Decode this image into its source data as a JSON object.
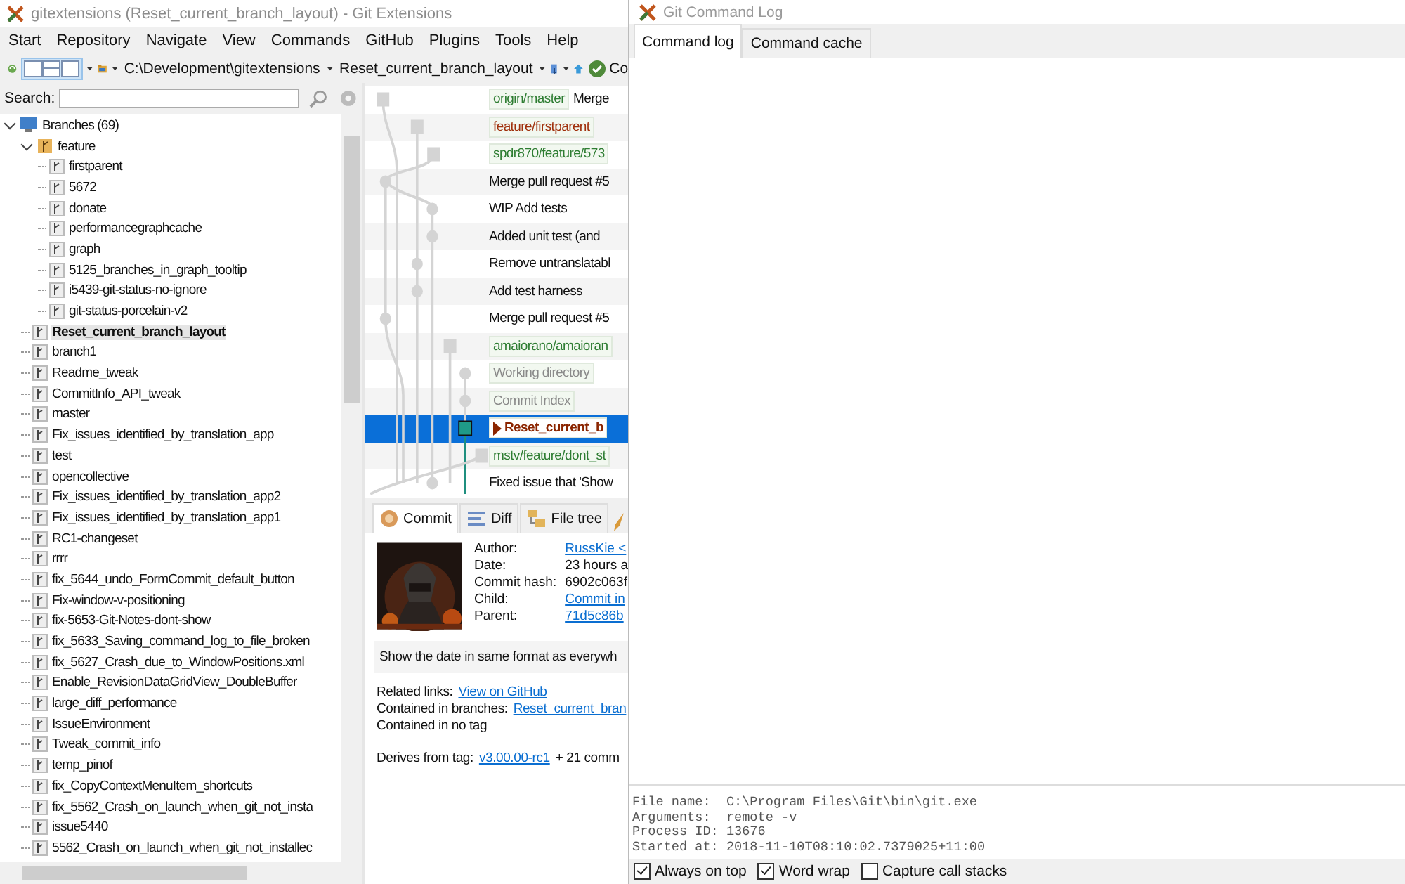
{
  "main_window": {
    "title": "gitextensions (Reset_current_branch_layout) - Git Extensions"
  },
  "menu": [
    "Start",
    "Repository",
    "Navigate",
    "View",
    "Commands",
    "GitHub",
    "Plugins",
    "Tools",
    "Help"
  ],
  "toolbar": {
    "repository": "C:\\Development\\gitextensions",
    "branch": "Reset_current_branch_layout",
    "button_text": "Co"
  },
  "sidebar": {
    "search_label": "Search:",
    "tree": [
      {
        "label": "Branches (69)",
        "kind": "root",
        "expanded": true,
        "selected": false,
        "children": [
          {
            "label": "feature",
            "kind": "folder",
            "expanded": true,
            "selected": false,
            "children": [
              {
                "label": "firstparent",
                "kind": "branch",
                "selected": false
              },
              {
                "label": "5672",
                "kind": "branch",
                "selected": false
              },
              {
                "label": "donate",
                "kind": "branch",
                "selected": false
              },
              {
                "label": "performancegraphcache",
                "kind": "branch",
                "selected": false
              },
              {
                "label": "graph",
                "kind": "branch",
                "selected": false
              },
              {
                "label": "5125_branches_in_graph_tooltip",
                "kind": "branch",
                "selected": false
              },
              {
                "label": "i5439-git-status-no-ignore",
                "kind": "branch",
                "selected": false
              },
              {
                "label": "git-status-porcelain-v2",
                "kind": "branch",
                "selected": false
              }
            ]
          },
          {
            "label": "Reset_current_branch_layout",
            "kind": "branch",
            "selected": true
          },
          {
            "label": "branch1",
            "kind": "branch",
            "selected": false
          },
          {
            "label": "Readme_tweak",
            "kind": "branch",
            "selected": false
          },
          {
            "label": "CommitInfo_API_tweak",
            "kind": "branch",
            "selected": false
          },
          {
            "label": "master",
            "kind": "branch",
            "selected": false
          },
          {
            "label": "Fix_issues_identified_by_translation_app",
            "kind": "branch",
            "selected": false
          },
          {
            "label": "test",
            "kind": "branch",
            "selected": false
          },
          {
            "label": "opencollective",
            "kind": "branch",
            "selected": false
          },
          {
            "label": "Fix_issues_identified_by_translation_app2",
            "kind": "branch",
            "selected": false
          },
          {
            "label": "Fix_issues_identified_by_translation_app1",
            "kind": "branch",
            "selected": false
          },
          {
            "label": "RC1-changeset",
            "kind": "branch",
            "selected": false
          },
          {
            "label": "rrrr",
            "kind": "branch",
            "selected": false
          },
          {
            "label": "fix_5644_undo_FormCommit_default_button",
            "kind": "branch",
            "selected": false
          },
          {
            "label": "Fix-window-v-positioning",
            "kind": "branch",
            "selected": false
          },
          {
            "label": "fix-5653-Git-Notes-dont-show",
            "kind": "branch",
            "selected": false
          },
          {
            "label": "fix_5633_Saving_command_log_to_file_broken",
            "kind": "branch",
            "selected": false
          },
          {
            "label": "fix_5627_Crash_due_to_WindowPositions.xml",
            "kind": "branch",
            "selected": false
          },
          {
            "label": "Enable_RevisionDataGridView_DoubleBuffer",
            "kind": "branch",
            "selected": false
          },
          {
            "label": "large_diff_performance",
            "kind": "branch",
            "selected": false
          },
          {
            "label": "IssueEnvironment",
            "kind": "branch",
            "selected": false
          },
          {
            "label": "Tweak_commit_info",
            "kind": "branch",
            "selected": false
          },
          {
            "label": "temp_pinof",
            "kind": "branch",
            "selected": false
          },
          {
            "label": "fix_CopyContextMenuItem_shortcuts",
            "kind": "branch",
            "selected": false
          },
          {
            "label": "fix_5562_Crash_on_launch_when_git_not_insta",
            "kind": "branch",
            "selected": false
          },
          {
            "label": "issue5440",
            "kind": "branch",
            "selected": false
          },
          {
            "label": "5562_Crash_on_launch_when_git_not_installec",
            "kind": "branch",
            "selected": false
          }
        ]
      }
    ]
  },
  "revisions": [
    {
      "ref": {
        "text": "origin/master",
        "color": "#2e7d32",
        "head": false
      },
      "message": "Merge",
      "selected": false
    },
    {
      "ref": {
        "text": "feature/firstparent",
        "color": "#a0300c",
        "head": false
      },
      "selected": false
    },
    {
      "ref": {
        "text": "spdr870/feature/573",
        "color": "#2e7d32",
        "head": false
      },
      "selected": false
    },
    {
      "message": "Merge pull request #5",
      "selected": false
    },
    {
      "message": "WIP Add tests",
      "selected": false
    },
    {
      "message": "Added unit test (and",
      "selected": false
    },
    {
      "message": "Remove untranslatabl",
      "selected": false
    },
    {
      "message": "Add test harness",
      "selected": false
    },
    {
      "message": "Merge pull request #5",
      "selected": false
    },
    {
      "ref": {
        "text": "amaiorano/amaioran",
        "color": "#2e7d32",
        "head": false
      },
      "selected": false
    },
    {
      "ref": {
        "text": "Working directory",
        "color": "#8a8a8a",
        "head": false
      },
      "selected": false
    },
    {
      "ref": {
        "text": "Commit Index",
        "color": "#8a8a8a",
        "head": false
      },
      "selected": false
    },
    {
      "ref": {
        "text": "Reset_current_b",
        "color": "#8b2500",
        "head": true
      },
      "selected": true
    },
    {
      "ref": {
        "text": "mstv/feature/dont_st",
        "color": "#2e7d32",
        "head": false
      },
      "selected": false
    },
    {
      "message": "Fixed issue that 'Show",
      "selected": false
    }
  ],
  "details": {
    "tabs": [
      {
        "label": "Commit",
        "selected": true
      },
      {
        "label": "Diff",
        "selected": false
      },
      {
        "label": "File tree",
        "selected": false
      }
    ],
    "fields": [
      {
        "label": "Author:",
        "value": "RussKie <",
        "link": true
      },
      {
        "label": "Date:",
        "value": "23 hours a",
        "link": false
      },
      {
        "label": "Commit hash:",
        "value": "6902c063f",
        "link": false
      },
      {
        "label": "Child:",
        "value": "Commit in",
        "link": true
      },
      {
        "label": "Parent:",
        "value": "71d5c86b",
        "link": true
      }
    ],
    "message": "Show the date in same format as everywh",
    "related_label": "Related links:",
    "related_link": "View on GitHub",
    "branches_label": "Contained in branches:",
    "branches_link": "Reset_current_bran",
    "tags_text": "Contained in no tag",
    "derives_label": "Derives from tag:",
    "derives_link": "v3.00.00-rc1",
    "derives_rest": "+ 21 comm"
  },
  "command_log": {
    "title": "Git Command Log",
    "tabs": [
      {
        "label": "Command log",
        "selected": true
      },
      {
        "label": "Command cache",
        "selected": false
      }
    ],
    "info": [
      "File name:  C:\\Program Files\\Git\\bin\\git.exe",
      "Arguments:  remote -v",
      "Process ID: 13676",
      "Started at: 2018-11-10T08:10:02.7379025+11:00"
    ],
    "options": [
      {
        "label": "Always on top",
        "checked": true
      },
      {
        "label": "Word wrap",
        "checked": true
      },
      {
        "label": "Capture call stacks",
        "checked": false
      }
    ]
  }
}
